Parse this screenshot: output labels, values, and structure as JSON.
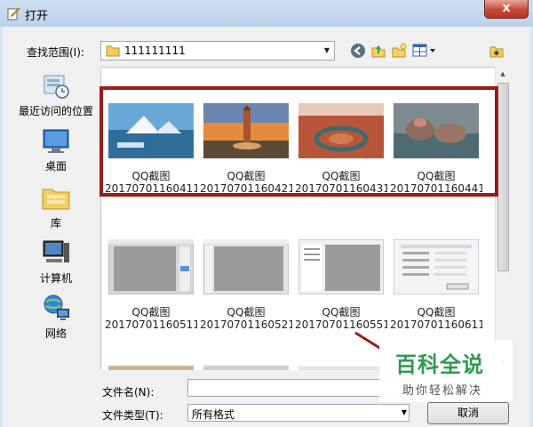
{
  "window": {
    "title": "打开",
    "close": "x"
  },
  "toolbar": {
    "look_in_label": "查找范围(I):",
    "look_in_value": "111111111"
  },
  "places": [
    {
      "label": "最近访问的位置",
      "icon": "recent-places-icon"
    },
    {
      "label": "桌面",
      "icon": "desktop-icon"
    },
    {
      "label": "库",
      "icon": "libraries-icon"
    },
    {
      "label": "计算机",
      "icon": "computer-icon"
    },
    {
      "label": "网络",
      "icon": "network-icon"
    }
  ],
  "files": [
    {
      "name1": "QQ截图",
      "name2": "20170701160411"
    },
    {
      "name1": "QQ截图",
      "name2": "20170701160421"
    },
    {
      "name1": "QQ截图",
      "name2": "20170701160431"
    },
    {
      "name1": "QQ截图",
      "name2": "20170701160441"
    },
    {
      "name1": "QQ截图",
      "name2": "20170701160511"
    },
    {
      "name1": "QQ截图",
      "name2": "20170701160521"
    },
    {
      "name1": "QQ截图",
      "name2": "20170701160551"
    },
    {
      "name1": "QQ截图",
      "name2": "20170701160611"
    }
  ],
  "footer": {
    "filename_label": "文件名(N):",
    "filename_value": "",
    "filetype_label": "文件类型(T):",
    "filetype_value": "所有格式",
    "cancel_label": "取消"
  },
  "watermark": {
    "title": "百科全说",
    "subtitle": "助你轻松解决"
  },
  "colors": {
    "highlight": "#9b1a1a",
    "watermark_green": "#2e9b4c",
    "close_red": "#c7493a"
  }
}
